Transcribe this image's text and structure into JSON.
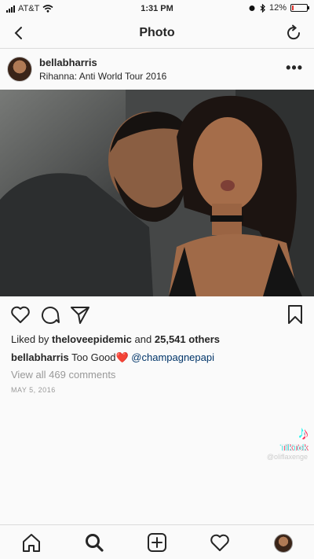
{
  "status_bar": {
    "carrier": "AT&T",
    "time": "1:31 PM",
    "battery": "12%",
    "battery_level": 0.12,
    "battery_color": "#e0312b"
  },
  "nav": {
    "title": "Photo",
    "back_icon": "chevron-left-icon",
    "refresh_icon": "refresh-icon"
  },
  "post": {
    "username": "bellabharris",
    "location": "Rihanna: Anti World Tour 2016",
    "more": "•••",
    "likes_prefix": "Liked by",
    "liked_by": "theloveepidemic",
    "likes_and": "and",
    "likes_count": "25,541 others",
    "caption_user": "bellabharris",
    "caption_text": "Too Good",
    "caption_emoji": "❤️",
    "caption_mention": "@champagnepapi",
    "view_comments": "View all 469 comments",
    "date": "MAY 5, 2016"
  },
  "actions": [
    "heart-icon",
    "comment-icon",
    "share-icon",
    "bookmark-icon"
  ],
  "watermark": {
    "brand": "TikTok",
    "handle": "@oliflaxenge"
  },
  "tab_bar": [
    "home-icon",
    "search-icon",
    "add-post-icon",
    "activity-heart-icon",
    "profile-avatar"
  ]
}
